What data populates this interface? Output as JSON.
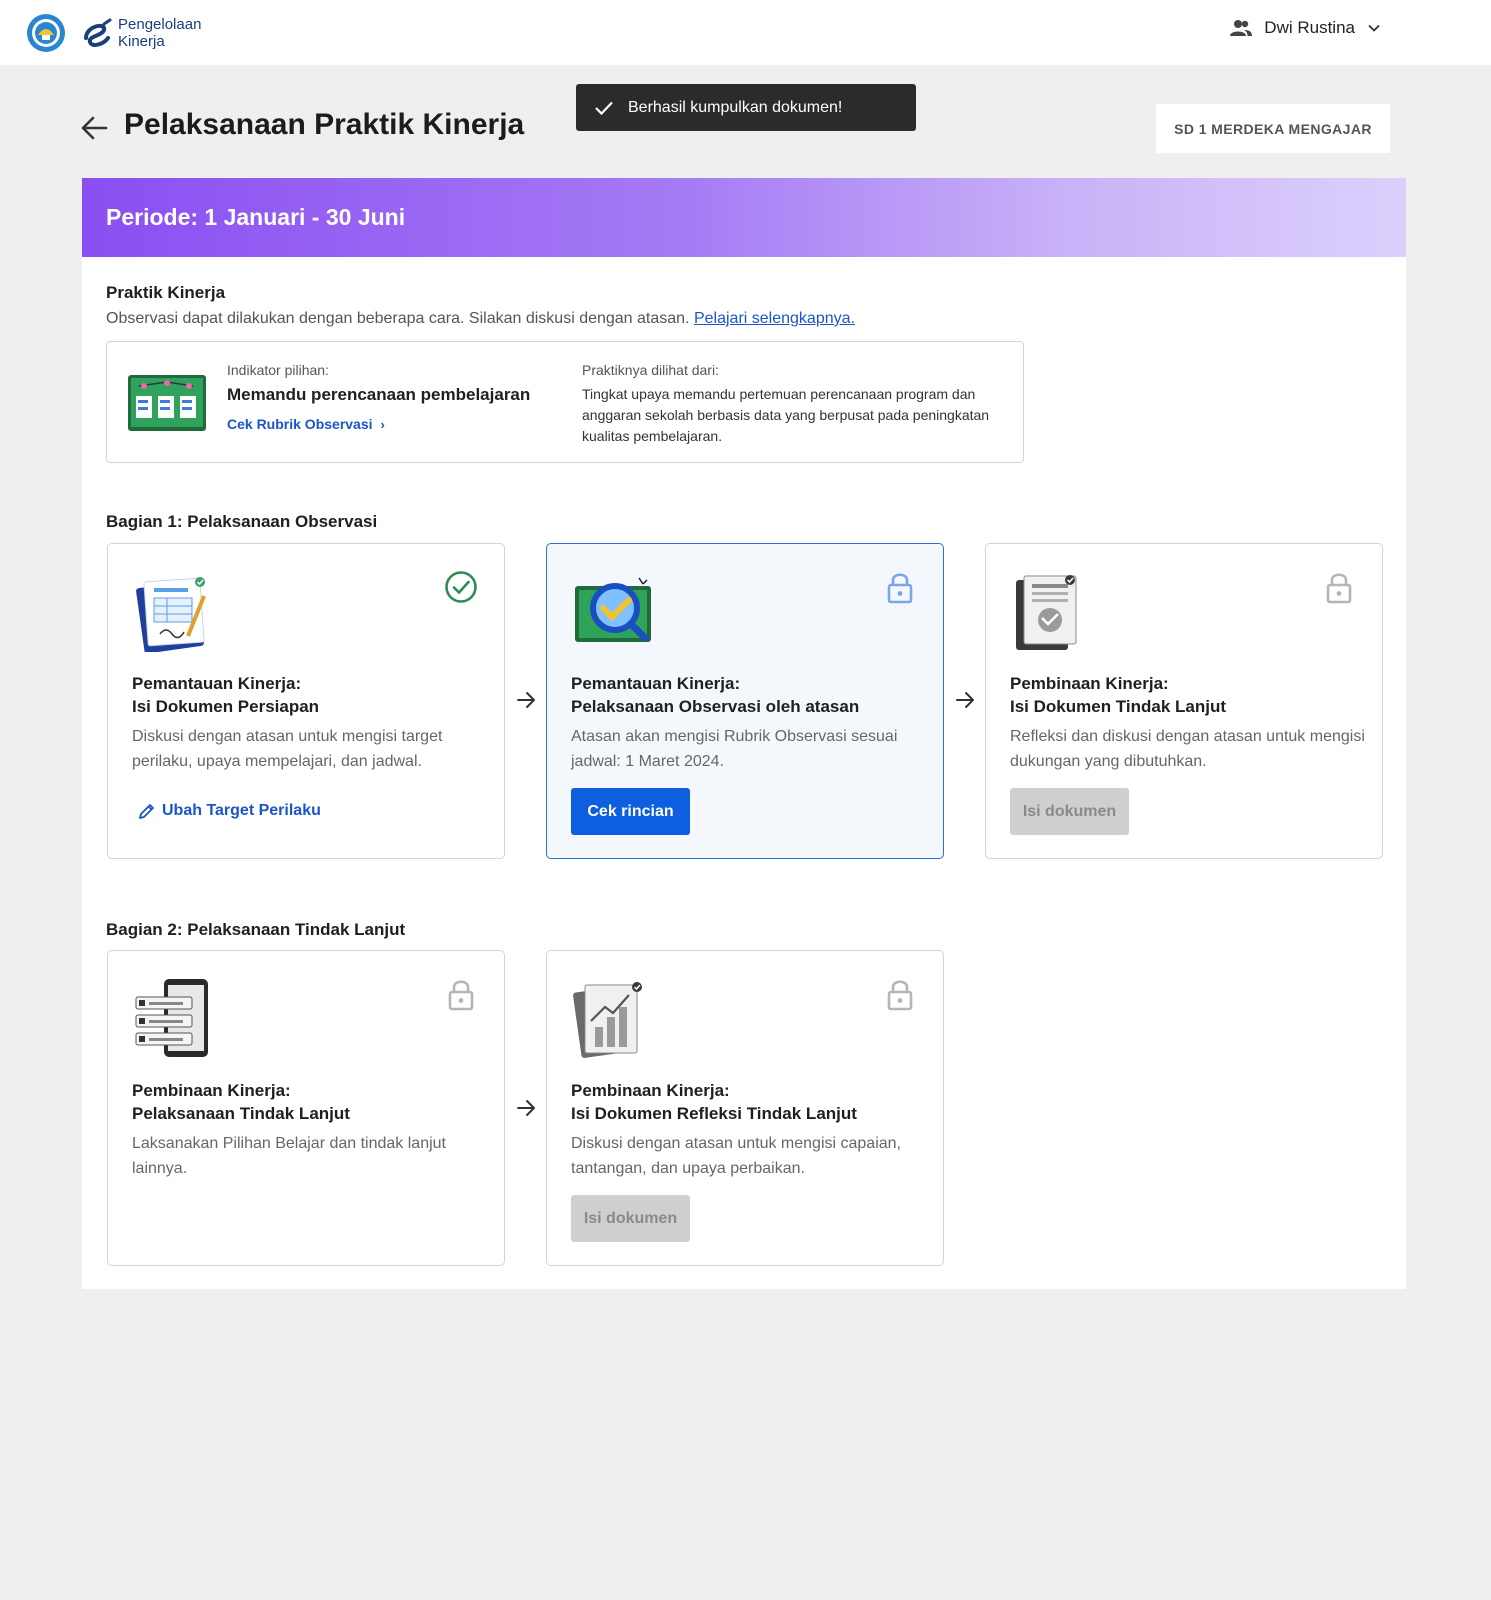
{
  "app": {
    "logo_line1": "Pengelolaan",
    "logo_line2": "Kinerja"
  },
  "user": {
    "name": "Dwi Rustina"
  },
  "toast": {
    "message": "Berhasil kumpulkan dokumen!"
  },
  "header": {
    "title": "Pelaksanaan Praktik Kinerja",
    "school": "SD 1 MERDEKA MENGAJAR"
  },
  "period": {
    "label": "Periode: 1 Januari - 30 Juni"
  },
  "practice": {
    "title": "Praktik Kinerja",
    "description": "Observasi dapat dilakukan dengan beberapa cara. Silakan diskusi dengan atasan.",
    "learn_more": "Pelajari selengkapnya.",
    "indicator_label": "Indikator pilihan:",
    "indicator_title": "Memandu perencanaan pembelajaran",
    "indicator_link": "Cek Rubrik Observasi",
    "seen_from_label": "Praktiknya dilihat dari:",
    "seen_from_text": "Tingkat upaya memandu pertemuan perencanaan program dan anggaran sekolah berbasis data yang berpusat pada peningkatan kualitas pembelajaran."
  },
  "part1": {
    "title": "Bagian 1: Pelaksanaan Observasi",
    "steps": [
      {
        "title_line1": "Pemantauan Kinerja:",
        "title_line2": "Isi Dokumen Persiapan",
        "desc": "Diskusi dengan atasan untuk mengisi target perilaku, upaya mempelajari, dan jadwal.",
        "action": "Ubah Target Perilaku",
        "status": "completed"
      },
      {
        "title_line1": "Pemantauan Kinerja:",
        "title_line2": "Pelaksanaan Observasi oleh atasan",
        "desc": "Atasan akan mengisi Rubrik Observasi sesuai jadwal: 1 Maret 2024.",
        "action": "Cek rincian",
        "status": "locked"
      },
      {
        "title_line1": "Pembinaan Kinerja:",
        "title_line2": "Isi Dokumen Tindak Lanjut",
        "desc": "Refleksi dan diskusi dengan atasan untuk mengisi dukungan yang dibutuhkan.",
        "action": "Isi dokumen",
        "status": "locked"
      }
    ]
  },
  "part2": {
    "title": "Bagian 2: Pelaksanaan Tindak Lanjut",
    "steps": [
      {
        "title_line1": "Pembinaan Kinerja:",
        "title_line2": "Pelaksanaan Tindak Lanjut",
        "desc": "Laksanakan Pilihan Belajar dan tindak lanjut lainnya.",
        "status": "locked"
      },
      {
        "title_line1": "Pembinaan Kinerja:",
        "title_line2": "Isi Dokumen Refleksi Tindak Lanjut",
        "desc": "Diskusi dengan atasan untuk mengisi capaian, tantangan, dan upaya perbaikan.",
        "action": "Isi dokumen",
        "status": "locked"
      }
    ]
  },
  "colors": {
    "primary": "#0d5fe0",
    "success": "#2e8b57",
    "banner_start": "#8a4ff1",
    "banner_end": "#dcd0fc",
    "lock_active": "#7aa6e6",
    "lock_muted": "#b5b5b5"
  },
  "icons": {
    "back": "arrow-left-icon",
    "user": "users-icon",
    "dropdown": "chevron-down-icon",
    "toast": "check-icon",
    "done": "check-circle-icon",
    "locked": "lock-icon",
    "edit": "pencil-icon",
    "next": "arrow-right-icon"
  }
}
